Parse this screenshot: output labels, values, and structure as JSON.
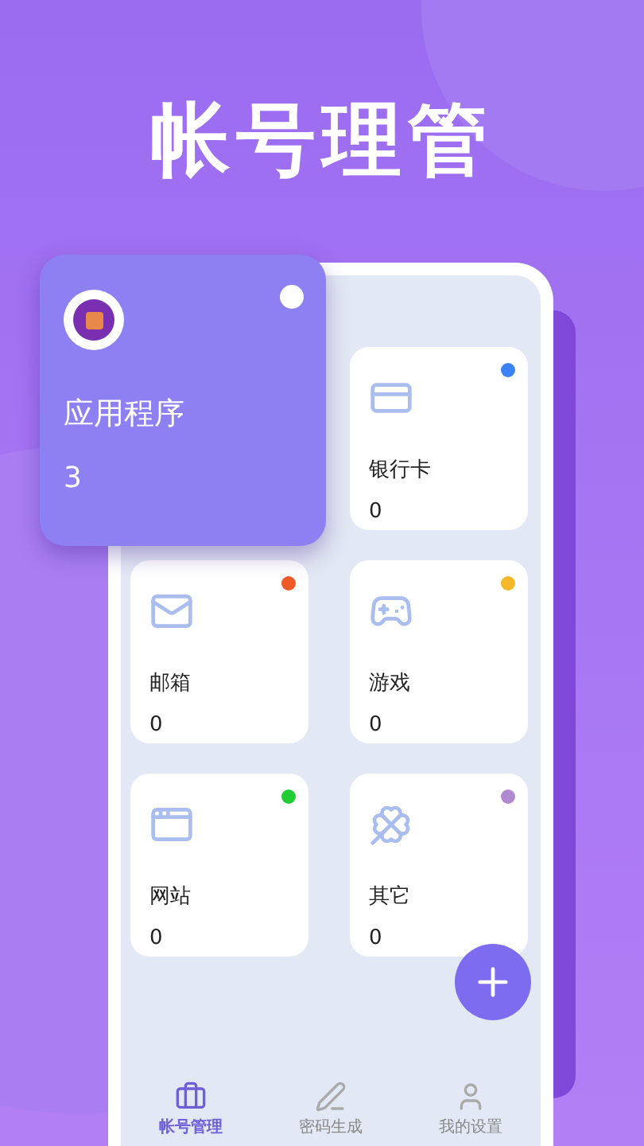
{
  "headline": "帐号理管",
  "featured": {
    "label": "应用程序",
    "count": "3",
    "color": "#ffffff"
  },
  "categories": [
    {
      "label": "银行卡",
      "count": "0",
      "color": "#3b82f6"
    },
    {
      "label": "邮箱",
      "count": "0",
      "color": "#f05a28"
    },
    {
      "label": "游戏",
      "count": "0",
      "color": "#f5b82a"
    },
    {
      "label": "网站",
      "count": "0",
      "color": "#22cc33"
    },
    {
      "label": "其它",
      "count": "0",
      "color": "#b08ad0"
    }
  ],
  "tabs": [
    {
      "label": "帐号管理",
      "selected": true
    },
    {
      "label": "密码生成",
      "selected": false
    },
    {
      "label": "我的设置",
      "selected": false
    }
  ]
}
